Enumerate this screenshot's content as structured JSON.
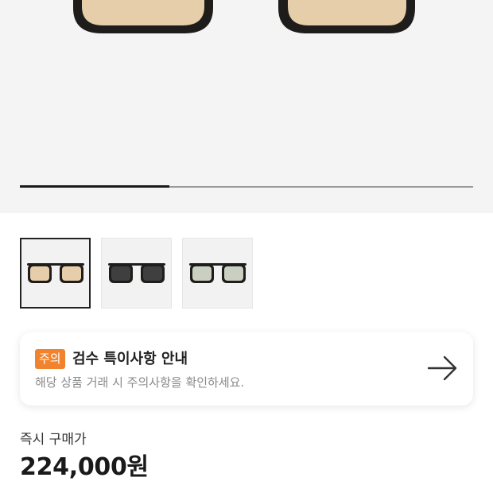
{
  "product": {
    "gallery": {
      "progress": 0.33,
      "hero_icon": "sunglasses-photo",
      "thumbnails": [
        {
          "name": "thumb-brown-lens",
          "lens_color": "#e6ceaa",
          "selected": true
        },
        {
          "name": "thumb-dark-lens",
          "lens_color": "#3f3f3f",
          "selected": false
        },
        {
          "name": "thumb-green-lens",
          "lens_color": "#c9cfc1",
          "selected": false
        }
      ]
    },
    "notice": {
      "badge": "주의",
      "title": "검수 특이사항 안내",
      "subtitle": "해당 상품 거래 시 주의사항을 확인하세요.",
      "icon": "arrow-right-icon"
    },
    "price": {
      "label": "즉시 구매가",
      "value": "224,000원"
    }
  },
  "colors": {
    "badge": "#f2832e",
    "hero_bg": "#f4f4f4",
    "frame": "#1f1d1b"
  }
}
